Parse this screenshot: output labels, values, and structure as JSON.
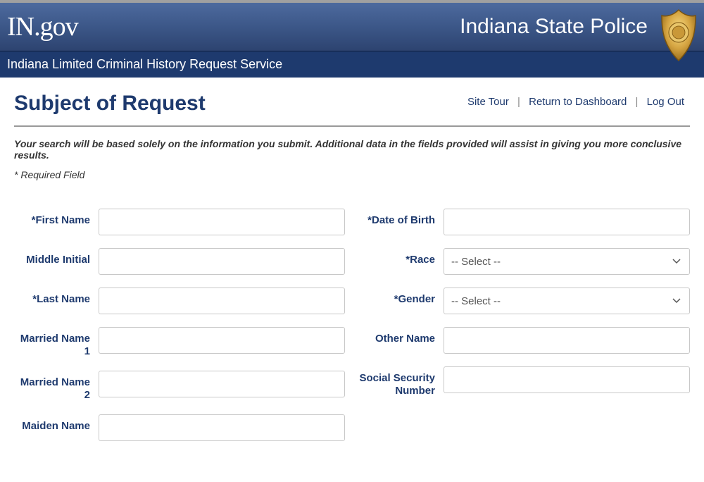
{
  "header": {
    "logo_text": "IN.gov",
    "agency": "Indiana State Police",
    "service_title": "Indiana Limited Criminal History Request Service"
  },
  "nav": {
    "site_tour": "Site Tour",
    "return_dashboard": "Return to Dashboard",
    "log_out": "Log Out"
  },
  "page": {
    "title": "Subject of Request",
    "instructions": "Your search will be based solely on the information you submit. Additional data in the fields provided will assist in giving you more conclusive results.",
    "required_note": "* Required Field"
  },
  "form": {
    "left": {
      "first_name": {
        "label": "*First Name",
        "value": ""
      },
      "middle_initial": {
        "label": "Middle Initial",
        "value": ""
      },
      "last_name": {
        "label": "*Last Name",
        "value": ""
      },
      "married_name_1": {
        "label": "Married Name 1",
        "value": ""
      },
      "married_name_2": {
        "label": "Married Name 2",
        "value": ""
      },
      "maiden_name": {
        "label": "Maiden Name",
        "value": ""
      }
    },
    "right": {
      "dob": {
        "label": "*Date of Birth",
        "value": ""
      },
      "race": {
        "label": "*Race",
        "selected": "-- Select --"
      },
      "gender": {
        "label": "*Gender",
        "selected": "-- Select --"
      },
      "other_name": {
        "label": "Other Name",
        "value": ""
      },
      "ssn": {
        "label": "Social Security Number",
        "value": ""
      }
    }
  }
}
